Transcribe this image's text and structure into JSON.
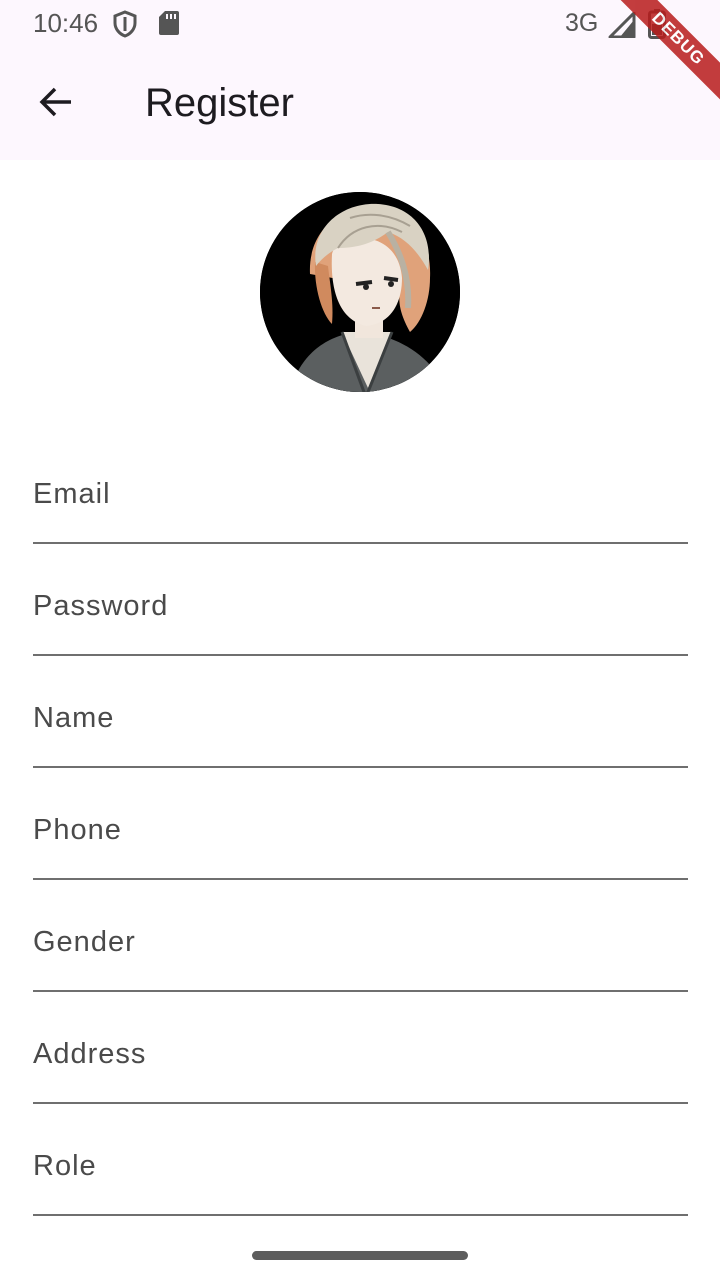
{
  "status_bar": {
    "time": "10:46",
    "network": "3G",
    "icons": [
      "shield-icon",
      "sd-card-icon",
      "signal-icon",
      "battery-icon"
    ]
  },
  "debug_banner": "DEBUG",
  "app_bar": {
    "back_icon": "arrow-back-icon",
    "title": "Register"
  },
  "avatar": {
    "description": "profile-avatar"
  },
  "form": {
    "fields": [
      {
        "label": "Email"
      },
      {
        "label": "Password"
      },
      {
        "label": "Name"
      },
      {
        "label": "Phone"
      },
      {
        "label": "Gender"
      },
      {
        "label": "Address"
      },
      {
        "label": "Role"
      }
    ]
  },
  "colors": {
    "app_bar_bg": "#fdf7fe",
    "underline": "#6f6f6f",
    "label_text": "#4a4a4a",
    "debug_banner": "#b81c1c"
  }
}
